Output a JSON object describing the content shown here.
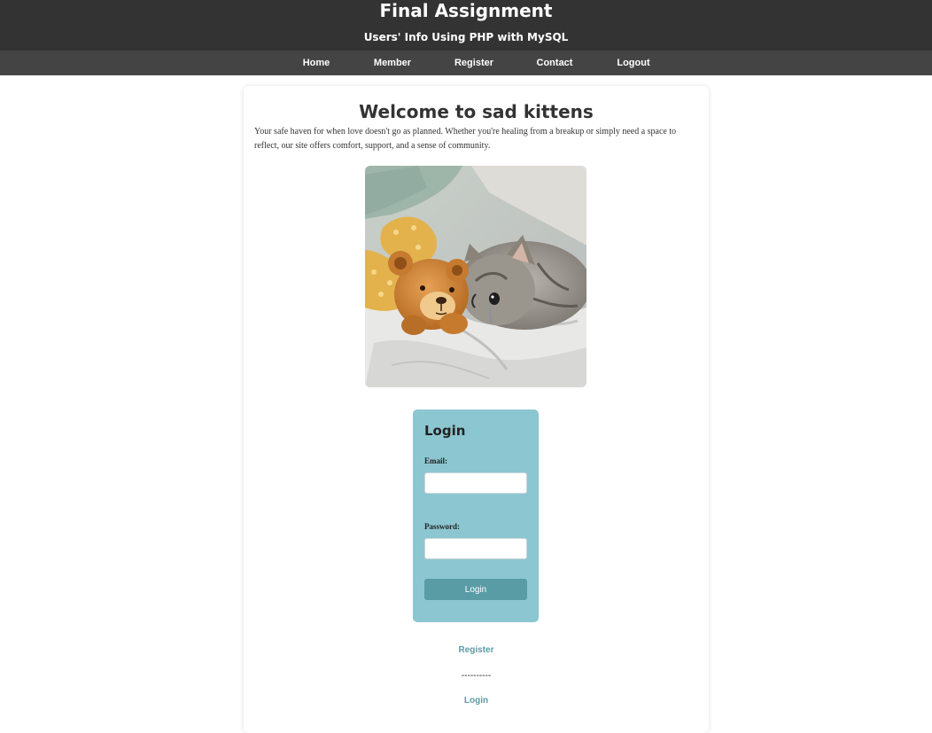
{
  "header": {
    "title": "Final Assignment",
    "subtitle": "Users' Info Using PHP with MySQL"
  },
  "nav": {
    "items": [
      {
        "label": "Home"
      },
      {
        "label": "Member"
      },
      {
        "label": "Register"
      },
      {
        "label": "Contact"
      },
      {
        "label": "Logout"
      }
    ]
  },
  "main": {
    "title": "Welcome to sad kittens",
    "intro": "Your safe haven for when love doesn't go as planned. Whether you're healing from a breakup or simply need a space to reflect, our site offers comfort, support, and a sense of community.",
    "image_subject": "sad kitten lying on a pillow next to a teddy bear"
  },
  "login": {
    "heading": "Login",
    "email_label": "Email:",
    "email_value": "",
    "password_label": "Password:",
    "password_value": "",
    "button_label": "Login"
  },
  "links": {
    "register": "Register",
    "divider": "----------",
    "login": "Login"
  },
  "colors": {
    "header_bg": "#333333",
    "nav_bg": "#444444",
    "login_box_bg": "#8cc6d1",
    "button_bg": "#5a9ca6",
    "link_color": "#5a9ca6"
  }
}
